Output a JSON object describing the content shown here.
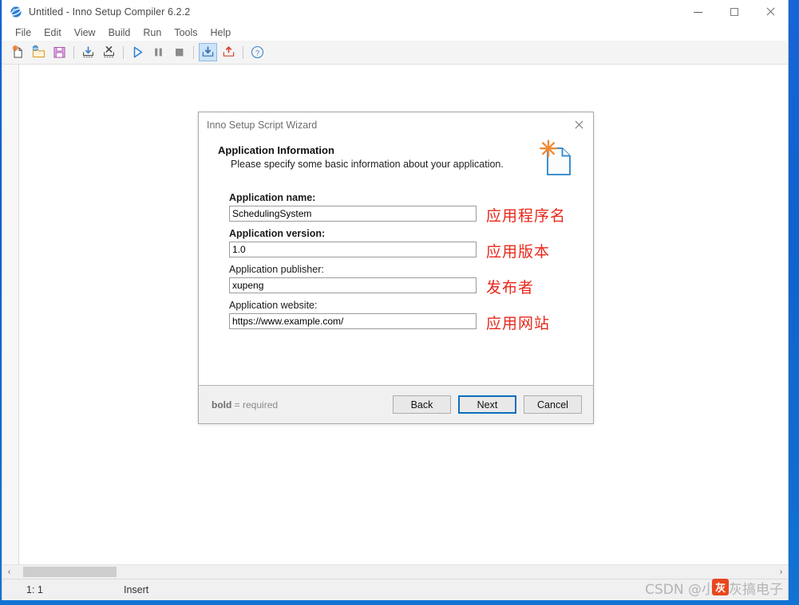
{
  "window": {
    "title": "Untitled - Inno Setup Compiler 6.2.2",
    "icon": "inno-globe-icon",
    "controls": {
      "minimize": "minimize-icon",
      "maximize": "maximize-icon",
      "close": "close-icon"
    }
  },
  "menu": {
    "items": [
      "File",
      "Edit",
      "View",
      "Build",
      "Run",
      "Tools",
      "Help"
    ]
  },
  "toolbar": {
    "buttons": [
      {
        "name": "new-file-icon",
        "group": 0
      },
      {
        "name": "open-file-icon",
        "group": 0
      },
      {
        "name": "save-file-icon",
        "group": 0
      },
      {
        "name": "import-icon",
        "group": 1
      },
      {
        "name": "remove-import-icon",
        "group": 1
      },
      {
        "name": "run-icon",
        "group": 2
      },
      {
        "name": "pause-icon",
        "group": 2
      },
      {
        "name": "stop-icon",
        "group": 2
      },
      {
        "name": "compile-icon",
        "group": 3,
        "active": true
      },
      {
        "name": "publish-icon",
        "group": 3
      },
      {
        "name": "help-icon",
        "group": 4
      }
    ]
  },
  "editor": {
    "gutter": "",
    "content": ""
  },
  "scrollbar": {
    "left_arrow": "‹",
    "right_arrow": "›"
  },
  "status_bar": {
    "position": "1:  1",
    "mode": "Insert"
  },
  "wizard": {
    "title": "Inno Setup Script Wizard",
    "close_icon": "close-icon",
    "header": {
      "title": "Application Information",
      "subtitle": "Please specify some basic information about your application.",
      "icon": "new-script-document-icon"
    },
    "fields": [
      {
        "label": "Application name:",
        "required": true,
        "value": "SchedulingSystem",
        "annotation": "应用程序名"
      },
      {
        "label": "Application version:",
        "required": true,
        "value": "1.0",
        "annotation": "应用版本"
      },
      {
        "label": "Application publisher:",
        "required": false,
        "value": "xupeng",
        "annotation": "发布者"
      },
      {
        "label": "Application website:",
        "required": false,
        "value": "https://www.example.com/",
        "annotation": "应用网站"
      }
    ],
    "footer": {
      "note_bold": "bold",
      "note_rest": "= required",
      "buttons": [
        {
          "label": "Back",
          "default": false
        },
        {
          "label": "Next",
          "default": true
        },
        {
          "label": "Cancel",
          "default": false
        }
      ]
    }
  },
  "watermark": {
    "text": "CSDN @小灰灰搞电子",
    "logo_text": "灰"
  },
  "colors": {
    "desktop_blue": "#1565d8",
    "annotation_red": "#e8281b",
    "default_button_border": "#0d6ebd",
    "toolbar_bg": "#f4f4f4",
    "footer_bg": "#f0f0f0"
  }
}
